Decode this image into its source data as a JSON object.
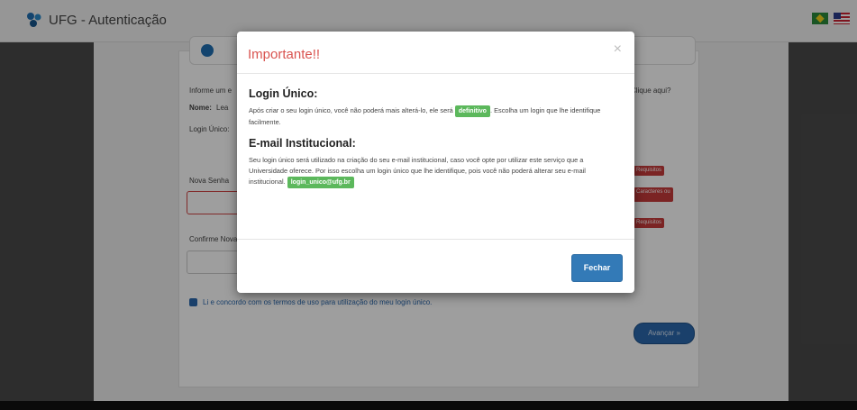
{
  "header": {
    "title": "UFG - Autenticação",
    "logo_icon": "ufg-logo-icon",
    "flags": [
      "brazil-flag-icon",
      "usa-flag-icon"
    ]
  },
  "form": {
    "intro": "Informe um e",
    "name_label": "Nome:",
    "name_value": "Lea",
    "login_label": "Login Único:",
    "trailing_text": "Clique aqui?",
    "new_password_label": "Nova Senha",
    "confirm_label": "Confirme Nova",
    "required_badges": [
      "Requisitos",
      "Caracteres ou",
      "Requisitos"
    ],
    "checkbox_label": "Li e concordo com os termos de uso para utilização do meu login único.",
    "next_button": "Avançar »"
  },
  "modal": {
    "title": "Importante!!",
    "close_symbol": "×",
    "sections": [
      {
        "heading": "Login Único:",
        "text_before": "Após criar o seu login único, você não poderá mais alterá-lo, ele será",
        "badge": "definitivo",
        "text_after": ". Escolha um login que lhe identifique facilmente."
      },
      {
        "heading": "E-mail Institucional:",
        "text_before": "Seu login único será utilizado na criação do seu e-mail institucional, caso você opte por utilizar este serviço que a Universidade oferece. Por isso escolha um login único que lhe identifique, pois você não poderá alterar seu e-mail institucional.",
        "badge": "login_unico@ufg.br",
        "text_after": ""
      }
    ],
    "footer_button": "Fechar"
  },
  "colors": {
    "title_red": "#d9534f",
    "badge_green": "#5cb85c",
    "button_blue": "#337ab7"
  }
}
